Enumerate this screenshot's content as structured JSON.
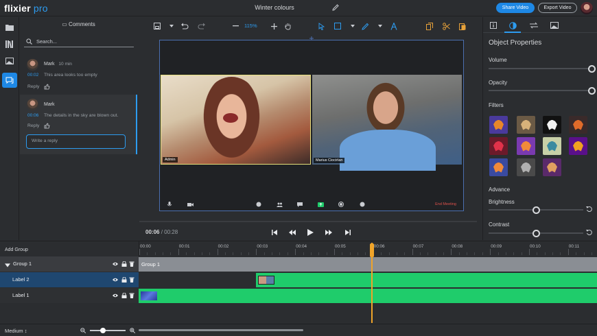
{
  "app": {
    "logo_main": "flixier",
    "logo_sub": "pro",
    "project_title": "Winter colours"
  },
  "header": {
    "share_label": "Share Video",
    "export_label": "Export Video"
  },
  "comments": {
    "title": "Comments",
    "search_placeholder": "Search...",
    "items": [
      {
        "author": "Mark",
        "time": "10 min",
        "timestamp": "00:02",
        "text": "This area looks too empty",
        "reply": "Reply"
      },
      {
        "author": "Mark",
        "time": "",
        "timestamp": "00:06",
        "text": "The details in the sky are blown out.",
        "reply": "Reply"
      }
    ],
    "reply_placeholder": "Write a reply"
  },
  "viewer": {
    "zoom": "115%",
    "participants": [
      "Admin",
      "Marius Ciocirlan"
    ],
    "end_meeting": "End Meeting",
    "current_time": "00:06",
    "separator": " / ",
    "total_time": "00:28"
  },
  "properties": {
    "title": "Object Properties",
    "volume_label": "Volume",
    "opacity_label": "Opacity",
    "filters_label": "Filters",
    "advance_label": "Advance",
    "brightness_label": "Brightness",
    "contrast_label": "Contrast",
    "volume": 1.0,
    "opacity": 1.0,
    "brightness": 0.5,
    "contrast": 0.5,
    "filters": [
      {
        "bg": "#4a3a9c",
        "fg": "#e8862a"
      },
      {
        "bg": "#6b5a45",
        "fg": "#d8b27a"
      },
      {
        "bg": "#111111",
        "fg": "#f2f2f2"
      },
      {
        "bg": "#3a2a2a",
        "fg": "#e06b2a"
      },
      {
        "bg": "#6b1a2a",
        "fg": "#e0324a"
      },
      {
        "bg": "#7a3ab0",
        "fg": "#f08a3a"
      },
      {
        "bg": "#c8d0a8",
        "fg": "#3a8aa0"
      },
      {
        "bg": "#5a108a",
        "fg": "#f0a020"
      },
      {
        "bg": "#3a4aa0",
        "fg": "#f08a3a"
      },
      {
        "bg": "#4a4a4a",
        "fg": "#b0b0b0"
      },
      {
        "bg": "#5a2a6a",
        "fg": "#e0a060"
      }
    ]
  },
  "timeline": {
    "add_group": "Add Group",
    "ticks": [
      "00:00",
      "00:01",
      "00:02",
      "00:03",
      "00:04",
      "00:05",
      "00:06",
      "00:07",
      "00:08",
      "00:09",
      "00:10",
      "00:11"
    ],
    "tracks": [
      {
        "name": "Group 1",
        "clip_label": "Group 1"
      },
      {
        "name": "Label 2"
      },
      {
        "name": "Label 1"
      }
    ],
    "quality": "Medium"
  },
  "colors": {
    "accent": "#1e88e5",
    "clip_green": "#1fcc6b",
    "playhead": "#f0a429"
  }
}
